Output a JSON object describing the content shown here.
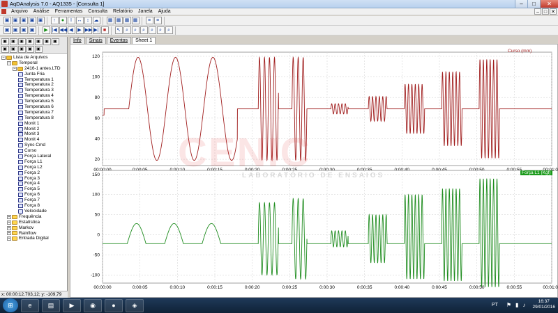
{
  "window": {
    "title": "AqDAnalysis 7.0 - AQ1335 - [Consulta 1]",
    "controls": [
      "–",
      "□",
      "✕"
    ]
  },
  "menu": {
    "items": [
      "Arquivo",
      "Análise",
      "Ferramentas",
      "Consulta",
      "Relatório",
      "Janela",
      "Ajuda"
    ],
    "mdi_controls": [
      "–",
      "□",
      "✕"
    ]
  },
  "toolbar1": {
    "groups": [
      [
        "▣",
        "▣",
        "▣",
        "▣",
        "▣"
      ],
      [
        "↑",
        "●",
        "I",
        "↔",
        "↕",
        "☁"
      ],
      [
        "▦",
        "▦",
        "▦",
        "▦"
      ],
      [
        "≡",
        "≡"
      ]
    ]
  },
  "toolbar2": {
    "groups": [
      [
        "▣",
        "▣",
        "▣",
        "▣"
      ],
      [
        "▶",
        "|◀",
        "◀◀",
        "◀",
        "▶",
        "▶▶",
        "▶|",
        "■"
      ],
      [
        "↖",
        "⌕",
        "⌕",
        "⌕",
        "⌕",
        "⌕",
        "⌕"
      ]
    ]
  },
  "tabs": [
    "Info",
    "Sinais",
    "Eventos",
    "Sheet 1"
  ],
  "tree": [
    {
      "label": "Lista de Arquivos",
      "level": 0,
      "kind": "folder"
    },
    {
      "label": "Temporal",
      "level": 1,
      "kind": "folder"
    },
    {
      "label": "2416-1 antes.LTD",
      "level": 2,
      "kind": "folder"
    },
    {
      "label": "Junta Fria",
      "level": 3,
      "kind": "channel"
    },
    {
      "label": "Temperatura 1",
      "level": 3,
      "kind": "channel"
    },
    {
      "label": "Temperatura 2",
      "level": 3,
      "kind": "channel"
    },
    {
      "label": "Temperatura 3",
      "level": 3,
      "kind": "channel"
    },
    {
      "label": "Temperatura 4",
      "level": 3,
      "kind": "channel"
    },
    {
      "label": "Temperatura 5",
      "level": 3,
      "kind": "channel"
    },
    {
      "label": "Temperatura 6",
      "level": 3,
      "kind": "channel"
    },
    {
      "label": "Temperatura 7",
      "level": 3,
      "kind": "channel"
    },
    {
      "label": "Temperatura 8",
      "level": 3,
      "kind": "channel"
    },
    {
      "label": "Monit 1",
      "level": 3,
      "kind": "channel"
    },
    {
      "label": "Monit 2",
      "level": 3,
      "kind": "channel"
    },
    {
      "label": "Monit 3",
      "level": 3,
      "kind": "channel"
    },
    {
      "label": "Monit 4",
      "level": 3,
      "kind": "channel"
    },
    {
      "label": "Sync Cmd",
      "level": 3,
      "kind": "channel"
    },
    {
      "label": "Curso",
      "level": 3,
      "kind": "channel"
    },
    {
      "label": "Força Lateral",
      "level": 3,
      "kind": "channel"
    },
    {
      "label": "Força L1",
      "level": 3,
      "kind": "channel"
    },
    {
      "label": "Força L2",
      "level": 3,
      "kind": "channel"
    },
    {
      "label": "Força 2",
      "level": 3,
      "kind": "channel"
    },
    {
      "label": "Força 3",
      "level": 3,
      "kind": "channel"
    },
    {
      "label": "Força 4",
      "level": 3,
      "kind": "channel"
    },
    {
      "label": "Força 5",
      "level": 3,
      "kind": "channel"
    },
    {
      "label": "Força 6",
      "level": 3,
      "kind": "channel"
    },
    {
      "label": "Força 7",
      "level": 3,
      "kind": "channel"
    },
    {
      "label": "Força 8",
      "level": 3,
      "kind": "channel"
    },
    {
      "label": "Velocidade",
      "level": 3,
      "kind": "channel"
    },
    {
      "label": "Frequência",
      "level": 1,
      "kind": "yfolder"
    },
    {
      "label": "Estatística",
      "level": 1,
      "kind": "yfolder"
    },
    {
      "label": "Markov",
      "level": 1,
      "kind": "yfolder"
    },
    {
      "label": "Rainflow",
      "level": 1,
      "kind": "yfolder"
    },
    {
      "label": "Entrada Digital",
      "level": 1,
      "kind": "yfolder"
    }
  ],
  "status": {
    "coords": "x: 00:00:12.703,12; y: -109,79"
  },
  "watermark": {
    "logo": "CENIC",
    "subtitle": "LABORATÓRIO DE ENSAIOS"
  },
  "taskbar": {
    "language": "PT",
    "time": "16:37",
    "date": "29/01/2016"
  },
  "colors": {
    "curso": "#a01d1d",
    "forca": "#1e8c1e",
    "legend_green_bg": "#1a9a1a"
  },
  "chart_data": [
    {
      "type": "line",
      "legend": "Curso (mm)",
      "ylim": [
        14,
        124
      ],
      "yticks": [
        20,
        40,
        60,
        80,
        100,
        120
      ],
      "xlim": [
        0,
        60
      ],
      "xticks": [
        "00:00:00",
        "0:00:05",
        "0:00:10",
        "0:00:15",
        "0:00:20",
        "0:00:25",
        "0:00:30",
        "0:00:35",
        "0:00:40",
        "0:00:45",
        "0:00:50",
        "0:00:55",
        "00:01:00"
      ],
      "baseline": 69,
      "segments": [
        {
          "start": 0.0,
          "end": 0.2,
          "center": 63,
          "amp": 0,
          "freq": 0
        },
        {
          "start": 0.2,
          "end": 3.5,
          "center": 69,
          "amp": 0,
          "freq": 0
        },
        {
          "start": 3.5,
          "end": 18.0,
          "center": 69,
          "amp": 50,
          "freq": 0.2
        },
        {
          "start": 18.0,
          "end": 20.8,
          "center": 69,
          "amp": 0,
          "freq": 0
        },
        {
          "start": 20.8,
          "end": 23.5,
          "center": 69,
          "amp": 50,
          "freq": 1.5
        },
        {
          "start": 23.5,
          "end": 25.3,
          "center": 69,
          "amp": 0,
          "freq": 0
        },
        {
          "start": 25.3,
          "end": 27.3,
          "center": 69,
          "amp": 50,
          "freq": 1.5
        },
        {
          "start": 27.3,
          "end": 30.5,
          "center": 69,
          "amp": 0,
          "freq": 0
        },
        {
          "start": 30.5,
          "end": 32.8,
          "center": 69,
          "amp": 5,
          "freq": 2.2
        },
        {
          "start": 32.8,
          "end": 35.5,
          "center": 69,
          "amp": 0,
          "freq": 0
        },
        {
          "start": 35.5,
          "end": 38.0,
          "center": 69,
          "amp": 12,
          "freq": 2.2
        },
        {
          "start": 38.0,
          "end": 40.3,
          "center": 69,
          "amp": 0,
          "freq": 0
        },
        {
          "start": 40.3,
          "end": 43.0,
          "center": 69,
          "amp": 24,
          "freq": 2.2
        },
        {
          "start": 43.0,
          "end": 45.3,
          "center": 69,
          "amp": 0,
          "freq": 0
        },
        {
          "start": 45.3,
          "end": 48.0,
          "center": 69,
          "amp": 36,
          "freq": 2.2
        },
        {
          "start": 48.0,
          "end": 50.3,
          "center": 69,
          "amp": 0,
          "freq": 0
        },
        {
          "start": 50.3,
          "end": 53.0,
          "center": 69,
          "amp": 48,
          "freq": 2.2
        },
        {
          "start": 53.0,
          "end": 60.0,
          "center": 69,
          "amp": 0,
          "freq": 0
        }
      ]
    },
    {
      "type": "line",
      "legend": "Força L1 (Kgf)",
      "ylim": [
        -120,
        160
      ],
      "yticks": [
        -100,
        -50,
        0,
        50,
        100,
        150
      ],
      "xlim": [
        0,
        60
      ],
      "xticks": [
        "00:00:00",
        "0:00:05",
        "0:00:10",
        "0:00:15",
        "0:00:20",
        "0:00:25",
        "0:00:30",
        "0:00:35",
        "0:00:40",
        "0:00:45",
        "0:00:50",
        "0:00:55",
        "00:01:00"
      ],
      "baseline": -22,
      "segments": [
        {
          "start": 0.0,
          "end": 3.3,
          "center": -22,
          "amp": 0,
          "freq": 0
        },
        {
          "start": 3.3,
          "end": 18.0,
          "center": -22,
          "amp": 50,
          "freq": 0.2,
          "shape": "hump"
        },
        {
          "start": 18.0,
          "end": 20.8,
          "center": -22,
          "amp": 0,
          "freq": 0
        },
        {
          "start": 20.8,
          "end": 23.5,
          "center": -10,
          "amp": 90,
          "freq": 1.5
        },
        {
          "start": 23.5,
          "end": 25.3,
          "center": -22,
          "amp": 0,
          "freq": 0
        },
        {
          "start": 25.3,
          "end": 27.3,
          "center": -10,
          "amp": 100,
          "freq": 1.5
        },
        {
          "start": 27.3,
          "end": 30.5,
          "center": -22,
          "amp": 0,
          "freq": 0
        },
        {
          "start": 30.5,
          "end": 32.8,
          "center": -10,
          "amp": 20,
          "freq": 2.2
        },
        {
          "start": 32.8,
          "end": 35.5,
          "center": -22,
          "amp": 0,
          "freq": 0
        },
        {
          "start": 35.5,
          "end": 38.0,
          "center": -10,
          "amp": 60,
          "freq": 2.2
        },
        {
          "start": 38.0,
          "end": 40.3,
          "center": -22,
          "amp": 0,
          "freq": 0
        },
        {
          "start": 40.3,
          "end": 43.0,
          "center": -5,
          "amp": 105,
          "freq": 2.2
        },
        {
          "start": 43.0,
          "end": 45.3,
          "center": -22,
          "amp": 0,
          "freq": 0
        },
        {
          "start": 45.3,
          "end": 48.0,
          "center": 0,
          "amp": 115,
          "freq": 2.2
        },
        {
          "start": 48.0,
          "end": 50.3,
          "center": -22,
          "amp": 0,
          "freq": 0
        },
        {
          "start": 50.3,
          "end": 53.0,
          "center": 5,
          "amp": 135,
          "freq": 2.2
        },
        {
          "start": 53.0,
          "end": 60.0,
          "center": -22,
          "amp": 0,
          "freq": 0
        }
      ]
    }
  ]
}
